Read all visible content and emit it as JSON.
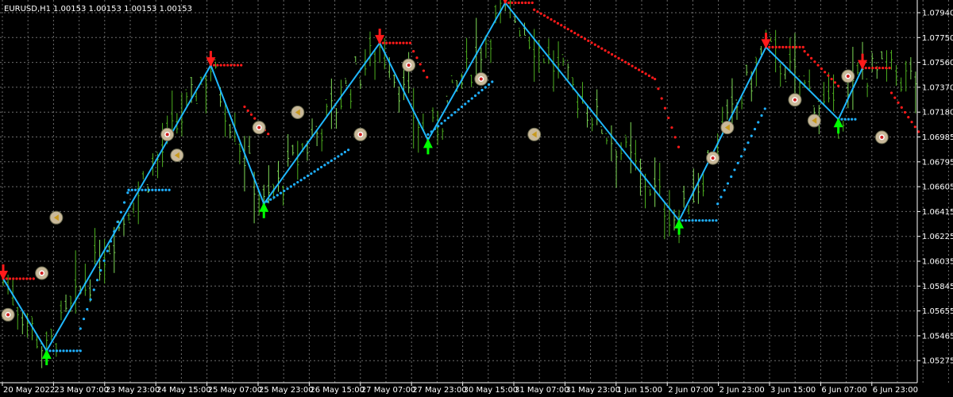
{
  "header": {
    "symbol_timeframe": "EURUSD,H1",
    "ohlc": "1.00153 1.00153 1.00153 1.00153"
  },
  "colors": {
    "background": "#000000",
    "grid": "#6c6c6c",
    "candle": "#4caf1f",
    "candle_light": "#7ed957",
    "zigzag": "#1fb8ff",
    "support_dots": "#1fb0ff",
    "resistance_dots": "#ff1a1a",
    "up_arrow": "#00ff00",
    "down_arrow": "#ff1a1a",
    "circle_marker": "#c9b99a"
  },
  "chart_data": {
    "type": "line",
    "title": "EURUSD,H1",
    "y_axis_labels": [
      "1.07940",
      "1.07750",
      "1.07560",
      "1.07370",
      "1.07180",
      "1.06985",
      "1.06795",
      "1.06605",
      "1.06415",
      "1.06225",
      "1.06035",
      "1.05845",
      "1.05655",
      "1.05465",
      "1.05275"
    ],
    "x_axis_labels": [
      "20 May 2022",
      "23 May 07:00",
      "23 May 23:00",
      "24 May 15:00",
      "25 May 07:00",
      "25 May 23:00",
      "26 May 15:00",
      "27 May 07:00",
      "27 May 23:00",
      "30 May 15:00",
      "31 May 07:00",
      "31 May 23:00",
      "1 Jun 15:00",
      "2 Jun 07:00",
      "2 Jun 23:00",
      "3 Jun 15:00",
      "6 Jun 07:00",
      "6 Jun 23:00"
    ],
    "ylim": [
      1.0521,
      1.0797
    ],
    "series": [
      {
        "role": "zigzag",
        "points": [
          {
            "bar": 0,
            "price": 1.0596
          },
          {
            "bar": 9,
            "price": 1.0544
          },
          {
            "bar": 43,
            "price": 1.075
          },
          {
            "bar": 54,
            "price": 1.065
          },
          {
            "bar": 78,
            "price": 1.0766
          },
          {
            "bar": 88,
            "price": 1.0696
          },
          {
            "bar": 104,
            "price": 1.0795
          },
          {
            "bar": 140,
            "price": 1.0638
          },
          {
            "bar": 158,
            "price": 1.0763
          },
          {
            "bar": 173,
            "price": 1.0711
          },
          {
            "bar": 178,
            "price": 1.0748
          }
        ]
      }
    ]
  }
}
